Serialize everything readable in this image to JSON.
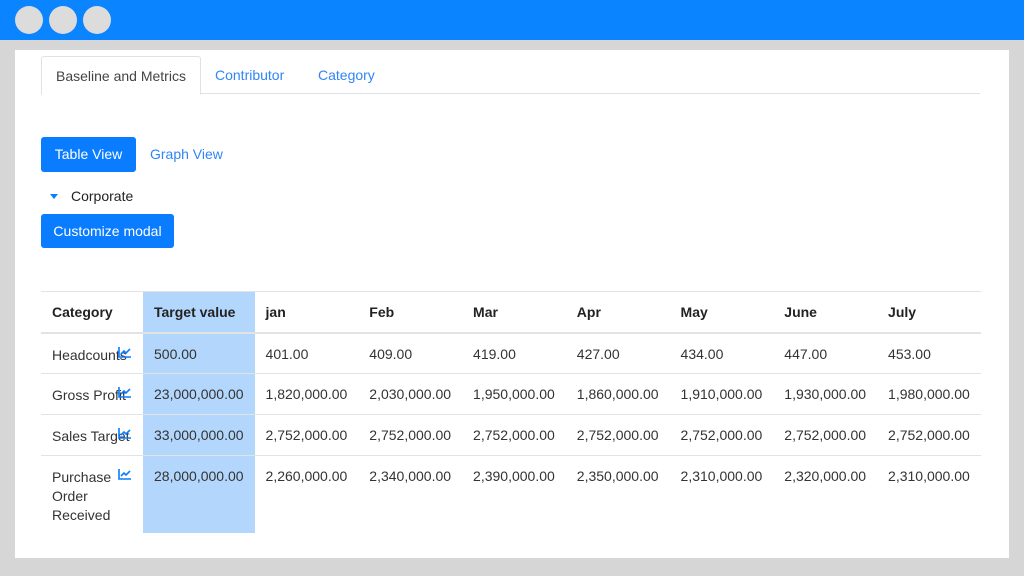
{
  "tabs": [
    {
      "label": "Baseline and Metrics",
      "active": true
    },
    {
      "label": "Contributor",
      "active": false
    },
    {
      "label": "Category",
      "active": false
    }
  ],
  "view_toggle": {
    "table_label": "Table View",
    "graph_label": "Graph View"
  },
  "group": {
    "label": "Corporate"
  },
  "customize_label": "Customize modal",
  "table": {
    "headers": [
      "Category",
      "Target value",
      "jan",
      "Feb",
      "Mar",
      "Apr",
      "May",
      "June",
      "July"
    ],
    "rows": [
      {
        "category": "Headcounts",
        "target": "500.00",
        "values": [
          "401.00",
          "409.00",
          "419.00",
          "427.00",
          "434.00",
          "447.00",
          "453.00"
        ]
      },
      {
        "category": "Gross Profit",
        "target": "23,000,000.00",
        "values": [
          "1,820,000.00",
          "2,030,000.00",
          "1,950,000.00",
          "1,860,000.00",
          "1,910,000.00",
          "1,930,000.00",
          "1,980,000.00"
        ]
      },
      {
        "category": "Sales Target",
        "target": "33,000,000.00",
        "values": [
          "2,752,000.00",
          "2,752,000.00",
          "2,752,000.00",
          "2,752,000.00",
          "2,752,000.00",
          "2,752,000.00",
          "2,752,000.00"
        ]
      },
      {
        "category": "Purchase Order Received",
        "target": "28,000,000.00",
        "values": [
          "2,260,000.00",
          "2,340,000.00",
          "2,390,000.00",
          "2,350,000.00",
          "2,310,000.00",
          "2,320,000.00",
          "2,310,000.00"
        ]
      }
    ]
  },
  "colors": {
    "accent": "#0a7cff",
    "titlebar": "#0a84ff",
    "highlight": "#b3d7fc"
  },
  "icons": {
    "row_action": "line-chart-icon",
    "group_toggle": "caret-down-icon"
  }
}
